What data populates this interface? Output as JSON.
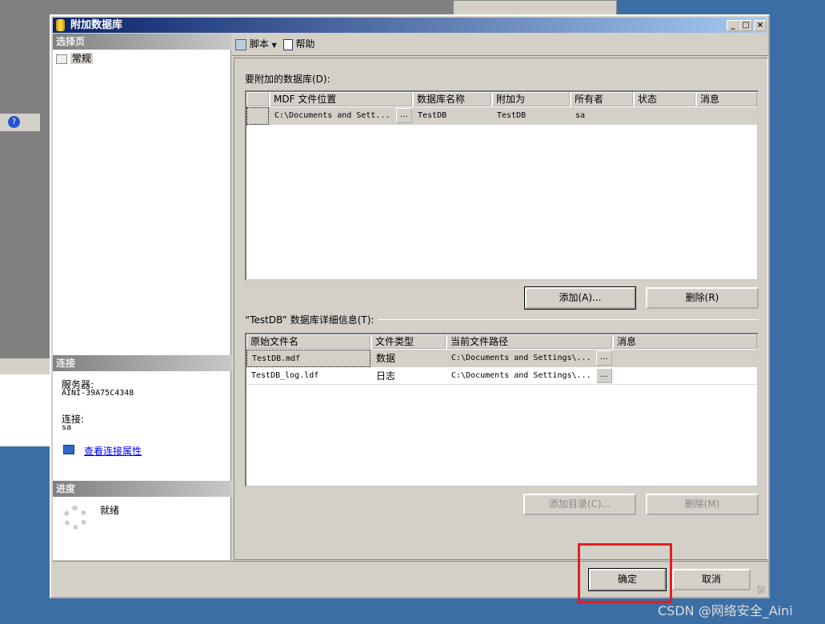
{
  "window": {
    "title": "附加数据库"
  },
  "left": {
    "select_page_header": "选择页",
    "pages": [
      {
        "label": "常规"
      }
    ],
    "connection_header": "连接",
    "server_label": "服务器:",
    "server_value": "AINI-39A75C4348",
    "connection_label": "连接:",
    "connection_value": "sa",
    "view_props_link": "查看连接属性",
    "progress_header": "进度",
    "progress_status": "就绪"
  },
  "toolbar": {
    "script_label": "脚本",
    "help_label": "帮助"
  },
  "attach": {
    "label": "要附加的数据库(D):",
    "columns": [
      "MDF 文件位置",
      "数据库名称",
      "附加为",
      "所有者",
      "状态",
      "消息"
    ],
    "rows": [
      {
        "mdf": "C:\\Documents and Sett...",
        "name": "TestDB",
        "attach_as": "TestDB",
        "owner": "sa",
        "status": "",
        "message": ""
      }
    ],
    "add_button": "添加(A)...",
    "remove_button": "删除(R)"
  },
  "details": {
    "label": "“TestDB” 数据库详细信息(T):",
    "columns": [
      "原始文件名",
      "文件类型",
      "当前文件路径",
      "消息"
    ],
    "rows": [
      {
        "file": "TestDB.mdf",
        "type": "数据",
        "path": "C:\\Documents and Settings\\...",
        "message": ""
      },
      {
        "file": "TestDB_log.ldf",
        "type": "日志",
        "path": "C:\\Documents and Settings\\...",
        "message": ""
      }
    ],
    "add_catalog_button": "添加目录(C)...",
    "remove_button": "删除(M)"
  },
  "footer": {
    "ok_button": "确定",
    "cancel_button": "取消"
  },
  "watermark": "CSDN @网络安全_Aini",
  "colors": {
    "highlight": "#e02020",
    "title_start": "#0a246a",
    "title_end": "#a6caf0"
  }
}
